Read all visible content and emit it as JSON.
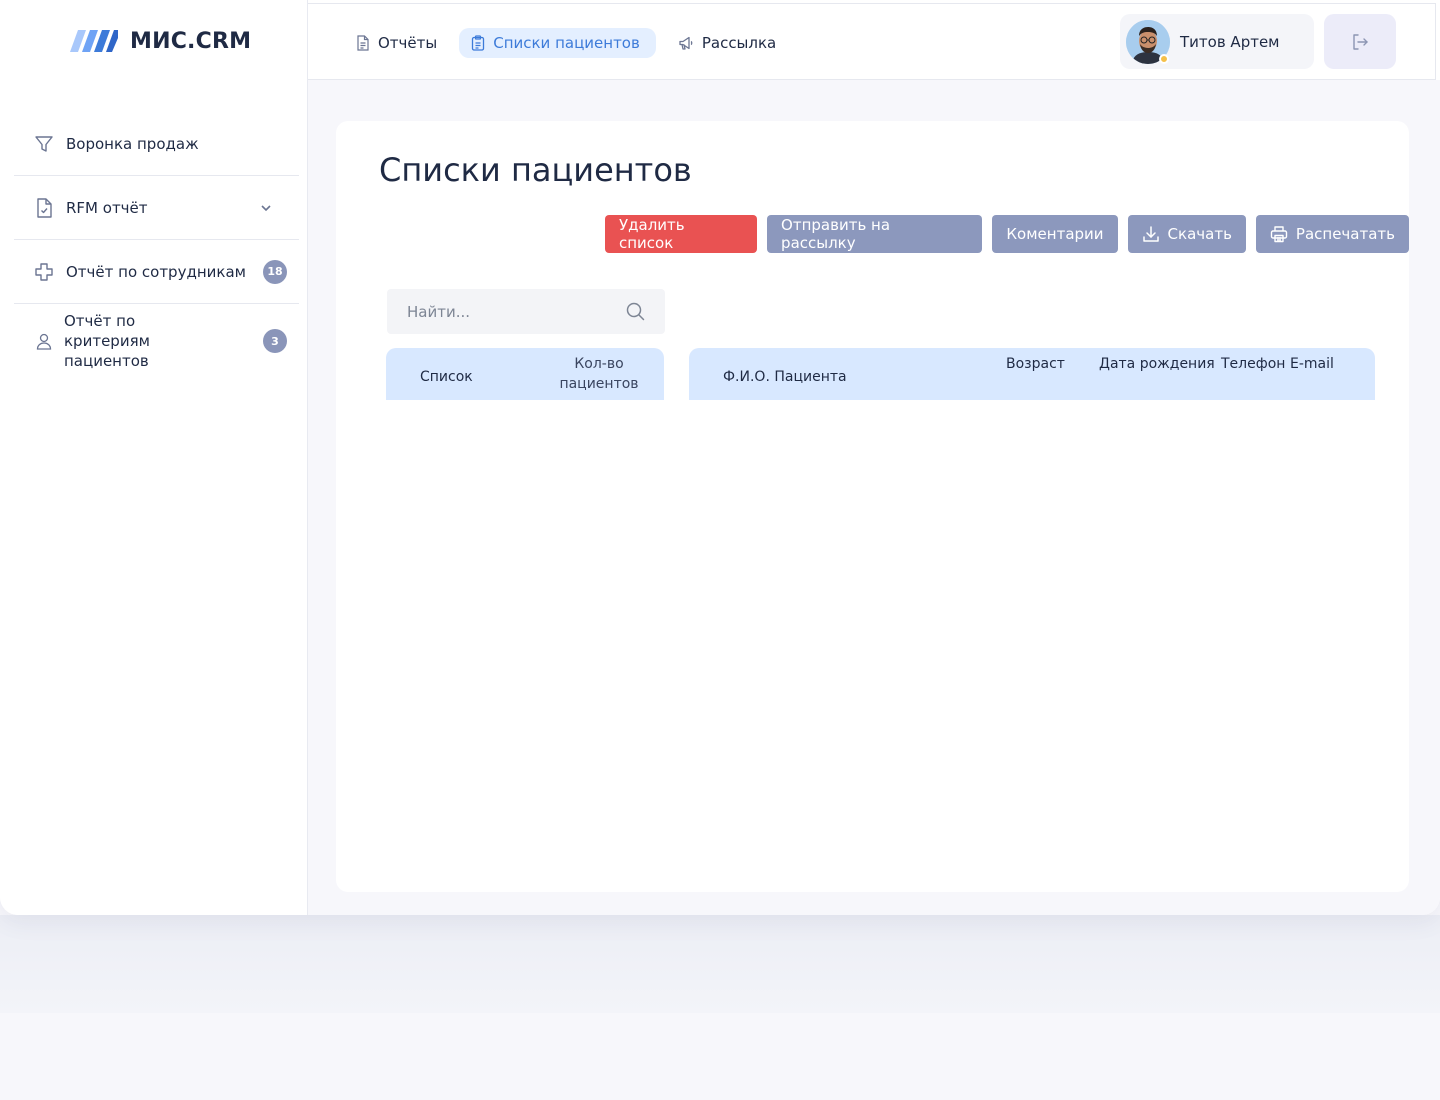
{
  "app": {
    "logo_text": "МИС.CRM"
  },
  "sidebar": {
    "items": [
      {
        "label": "Воронка продаж",
        "icon": "funnel-icon"
      },
      {
        "label": "RFM отчёт",
        "icon": "document-check-icon",
        "expandable": true
      },
      {
        "label": "Отчёт по сотрудникам",
        "icon": "plus-cross-icon",
        "badge": "18"
      },
      {
        "label": "Отчёт по критериям пациентов",
        "icon": "user-icon",
        "badge": "3"
      }
    ]
  },
  "topbar": {
    "nav": [
      {
        "label": "Отчёты",
        "icon": "document-icon"
      },
      {
        "label": "Списки пациентов",
        "icon": "clipboard-icon",
        "active": true
      },
      {
        "label": "Рассылка",
        "icon": "megaphone-icon"
      }
    ],
    "user": {
      "name": "Титов Артем"
    },
    "logout_icon": "logout-icon"
  },
  "main": {
    "title": "Списки пациентов",
    "actions": {
      "delete": "Удалить список",
      "send": "Отправить на рассылку",
      "comments": "Коментарии",
      "download": "Скачать",
      "print": "Распечатать"
    },
    "search": {
      "placeholder": "Найти..."
    },
    "lists_table": {
      "columns": [
        "Список",
        "Кол-во пациентов"
      ]
    },
    "patients_table": {
      "columns": [
        "Ф.И.О. Пациента",
        "Возраст",
        "Дата рождения",
        "Телефон",
        "E-mail"
      ]
    }
  },
  "colors": {
    "accent": "#3d7bd9",
    "danger": "#e95252",
    "muted_button": "#8c98bd",
    "table_header": "#d8e8ff"
  }
}
